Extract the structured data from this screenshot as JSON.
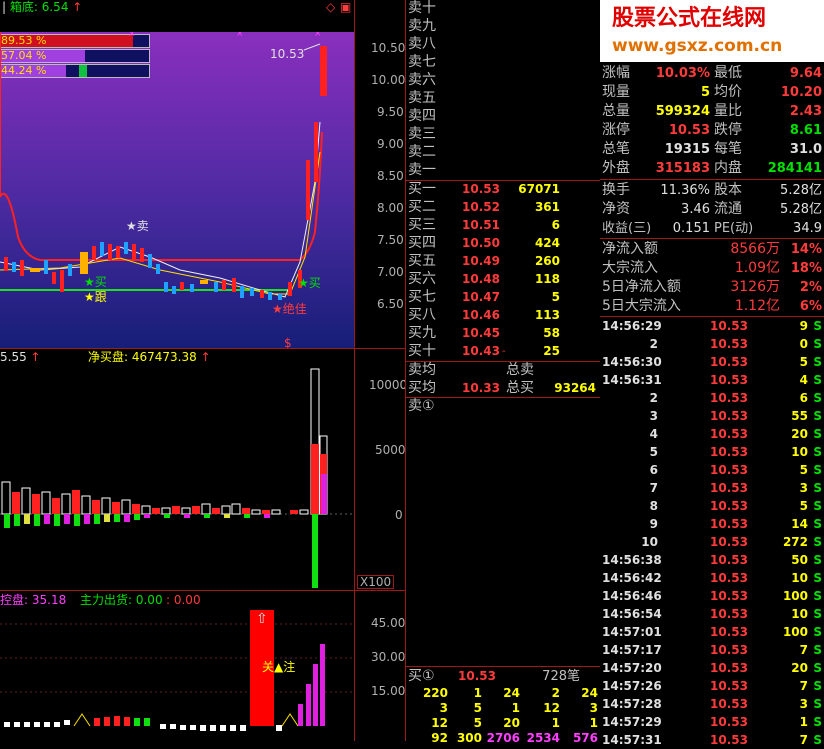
{
  "header": {
    "indicator_label": "箱底: 6.54",
    "arrow": "↑",
    "icons": [
      "diamond-icon",
      "window-icon"
    ]
  },
  "mini_bars": [
    {
      "label": "89.53 %",
      "fill": 0.8953,
      "color": "#d01020"
    },
    {
      "label": "57.04 %",
      "fill": 0.5704,
      "color": "#a040e0"
    },
    {
      "label": "44.24 %",
      "fill": 0.4424,
      "color": "#a040e0"
    }
  ],
  "price_chart": {
    "y_ticks": [
      "10.50",
      "10.00",
      "9.50",
      "9.00",
      "8.50",
      "8.00",
      "7.50",
      "7.00",
      "6.50"
    ],
    "last_price_label": "10.53",
    "annotations": {
      "sell": "★卖",
      "buy1": "★买",
      "follow": "★跟",
      "peak": "★绝佳",
      "buy2": "★买"
    },
    "marker": "$"
  },
  "volume_chart": {
    "label_left": "5.55",
    "label_main": "净买盘: 467473.38",
    "arrow": "↑",
    "y_ticks": [
      "10000",
      "5000",
      "0"
    ],
    "unit": "X100"
  },
  "control_chart": {
    "label_left": "控盘: 35.18",
    "label_out": "主力出货: 0.00",
    "label_extra": ": 0.00",
    "y_ticks": [
      "45.00",
      "30.00",
      "15.00"
    ],
    "focus_label": "关▲注",
    "up_arrow": "⇧"
  },
  "sell_levels": [
    "卖十",
    "卖九",
    "卖八",
    "卖七",
    "卖六",
    "卖五",
    "卖四",
    "卖三",
    "卖二",
    "卖一"
  ],
  "buy_levels": [
    {
      "name": "买一",
      "price": "10.53",
      "vol": "67071"
    },
    {
      "name": "买二",
      "price": "10.52",
      "vol": "361"
    },
    {
      "name": "买三",
      "price": "10.51",
      "vol": "6"
    },
    {
      "name": "买四",
      "price": "10.50",
      "vol": "424"
    },
    {
      "name": "买五",
      "price": "10.49",
      "vol": "260"
    },
    {
      "name": "买六",
      "price": "10.48",
      "vol": "118"
    },
    {
      "name": "买七",
      "price": "10.47",
      "vol": "5"
    },
    {
      "name": "买八",
      "price": "10.46",
      "vol": "113"
    },
    {
      "name": "买九",
      "price": "10.45",
      "vol": "58"
    },
    {
      "name": "买十",
      "price": "10.43",
      "vol": "25",
      "suffix": "-"
    }
  ],
  "averages": {
    "sell_avg": "卖均",
    "sell_total": "总卖",
    "buy_avg": "买均",
    "buy_avg_price": "10.33",
    "buy_total": "总买",
    "buy_total_vol": "93264"
  },
  "queue": {
    "sell_title": "卖①",
    "buy_title": "买①",
    "buy_price": "10.53",
    "buy_count": "728笔",
    "rows": [
      [
        "220",
        "1",
        "24",
        "2",
        "24"
      ],
      [
        "3",
        "5",
        "1",
        "12",
        "3"
      ],
      [
        "12",
        "5",
        "20",
        "1",
        "1"
      ],
      [
        "92",
        "300",
        "2706",
        "2534",
        "576"
      ]
    ]
  },
  "watermark": {
    "line1": "股票公式在线网",
    "line2": "www.gsxz.com.cn"
  },
  "stats_top": [
    {
      "k1": "涨幅",
      "v1": "10.03%",
      "c1": "red",
      "k2": "最低",
      "v2": "9.64",
      "c2": "red"
    },
    {
      "k1": "现量",
      "v1": "5",
      "c1": "yel",
      "k2": "均价",
      "v2": "10.20",
      "c2": "red"
    },
    {
      "k1": "总量",
      "v1": "599324",
      "c1": "yel",
      "k2": "量比",
      "v2": "2.43",
      "c2": "red"
    },
    {
      "k1": "涨停",
      "v1": "10.53",
      "c1": "red",
      "k2": "跌停",
      "v2": "8.61",
      "c2": "grn"
    },
    {
      "k1": "总笔",
      "v1": "19315",
      "c1": "wht",
      "k2": "每笔",
      "v2": "31.0",
      "c2": "wht"
    },
    {
      "k1": "外盘",
      "v1": "315183",
      "c1": "red",
      "k2": "内盘",
      "v2": "284141",
      "c2": "grn"
    }
  ],
  "stats_mid": [
    {
      "k1": "换手",
      "v1": "11.36%",
      "k2": "股本",
      "v2": "5.28亿"
    },
    {
      "k1": "净资",
      "v1": "3.46",
      "k2": "流通",
      "v2": "5.28亿"
    },
    {
      "k1": "收益(三)",
      "v1": "0.151",
      "k2": "PE(动)",
      "v2": "34.9"
    }
  ],
  "flows": [
    {
      "k": "净流入额",
      "v": "8566万",
      "p": "14%"
    },
    {
      "k": "大宗流入",
      "v": "1.09亿",
      "p": "18%"
    },
    {
      "k": "5日净流入额",
      "v": "3126万",
      "p": "2%"
    },
    {
      "k": "5日大宗流入",
      "v": "1.12亿",
      "p": "6%"
    }
  ],
  "trades": [
    {
      "t": "14:56:29",
      "p": "10.53",
      "v": "9",
      "s": "S"
    },
    {
      "t": "2",
      "p": "10.53",
      "v": "0",
      "s": "S"
    },
    {
      "t": "14:56:30",
      "p": "10.53",
      "v": "5",
      "s": "S"
    },
    {
      "t": "14:56:31",
      "p": "10.53",
      "v": "4",
      "s": "S"
    },
    {
      "t": "2",
      "p": "10.53",
      "v": "6",
      "s": "S"
    },
    {
      "t": "3",
      "p": "10.53",
      "v": "55",
      "s": "S"
    },
    {
      "t": "4",
      "p": "10.53",
      "v": "20",
      "s": "S"
    },
    {
      "t": "5",
      "p": "10.53",
      "v": "10",
      "s": "S"
    },
    {
      "t": "6",
      "p": "10.53",
      "v": "5",
      "s": "S"
    },
    {
      "t": "7",
      "p": "10.53",
      "v": "3",
      "s": "S"
    },
    {
      "t": "8",
      "p": "10.53",
      "v": "5",
      "s": "S"
    },
    {
      "t": "9",
      "p": "10.53",
      "v": "14",
      "s": "S"
    },
    {
      "t": "10",
      "p": "10.53",
      "v": "272",
      "s": "S"
    },
    {
      "t": "14:56:38",
      "p": "10.53",
      "v": "50",
      "s": "S"
    },
    {
      "t": "14:56:42",
      "p": "10.53",
      "v": "10",
      "s": "S"
    },
    {
      "t": "14:56:46",
      "p": "10.53",
      "v": "100",
      "s": "S"
    },
    {
      "t": "14:56:54",
      "p": "10.53",
      "v": "10",
      "s": "S"
    },
    {
      "t": "14:57:01",
      "p": "10.53",
      "v": "100",
      "s": "S"
    },
    {
      "t": "14:57:17",
      "p": "10.53",
      "v": "7",
      "s": "S"
    },
    {
      "t": "14:57:20",
      "p": "10.53",
      "v": "20",
      "s": "S"
    },
    {
      "t": "14:57:26",
      "p": "10.53",
      "v": "7",
      "s": "S"
    },
    {
      "t": "14:57:28",
      "p": "10.53",
      "v": "3",
      "s": "S"
    },
    {
      "t": "14:57:29",
      "p": "10.53",
      "v": "1",
      "s": "S"
    },
    {
      "t": "14:57:31",
      "p": "10.53",
      "v": "7",
      "s": "S"
    }
  ]
}
